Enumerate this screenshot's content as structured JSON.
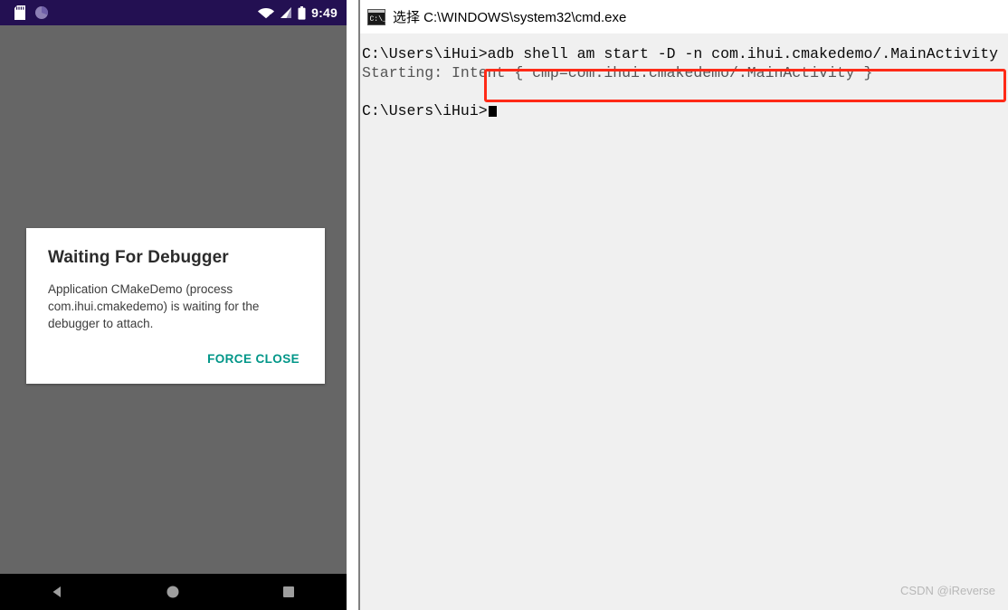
{
  "phone": {
    "statusbar": {
      "icons_left": [
        "sd-card-icon",
        "sync-icon"
      ],
      "icons_right": [
        "wifi-off-icon",
        "signal-icon",
        "battery-icon"
      ],
      "time": "9:49",
      "background_color": "#231052"
    },
    "dialog": {
      "title": "Waiting For Debugger",
      "message": "Application CMakeDemo (process com.ihui.cmakedemo) is waiting for the debugger to attach.",
      "action_label": "FORCE CLOSE",
      "action_color": "#009688"
    },
    "navbar": {
      "back_label": "back-button",
      "home_label": "home-button",
      "recents_label": "recents-button",
      "background_color": "#000000"
    },
    "scrim_color": "#666666"
  },
  "console": {
    "title": "选择 C:\\WINDOWS\\system32\\cmd.exe",
    "icon": "cmd-icon",
    "background_color": "#f0f0f0",
    "lines": [
      {
        "text": "C:\\Users\\iHui>adb shell am start -D -n com.ihui.cmakedemo/.MainActivity",
        "faded": false
      },
      {
        "text": "Starting: Intent { cmp=com.ihui.cmakedemo/.MainActivity }",
        "faded": true
      },
      {
        "text": "",
        "faded": false
      }
    ],
    "prompt": "C:\\Users\\iHui>",
    "highlight": {
      "name": "command-highlight",
      "color": "#ff2a17"
    }
  },
  "watermark": "CSDN @iReverse"
}
